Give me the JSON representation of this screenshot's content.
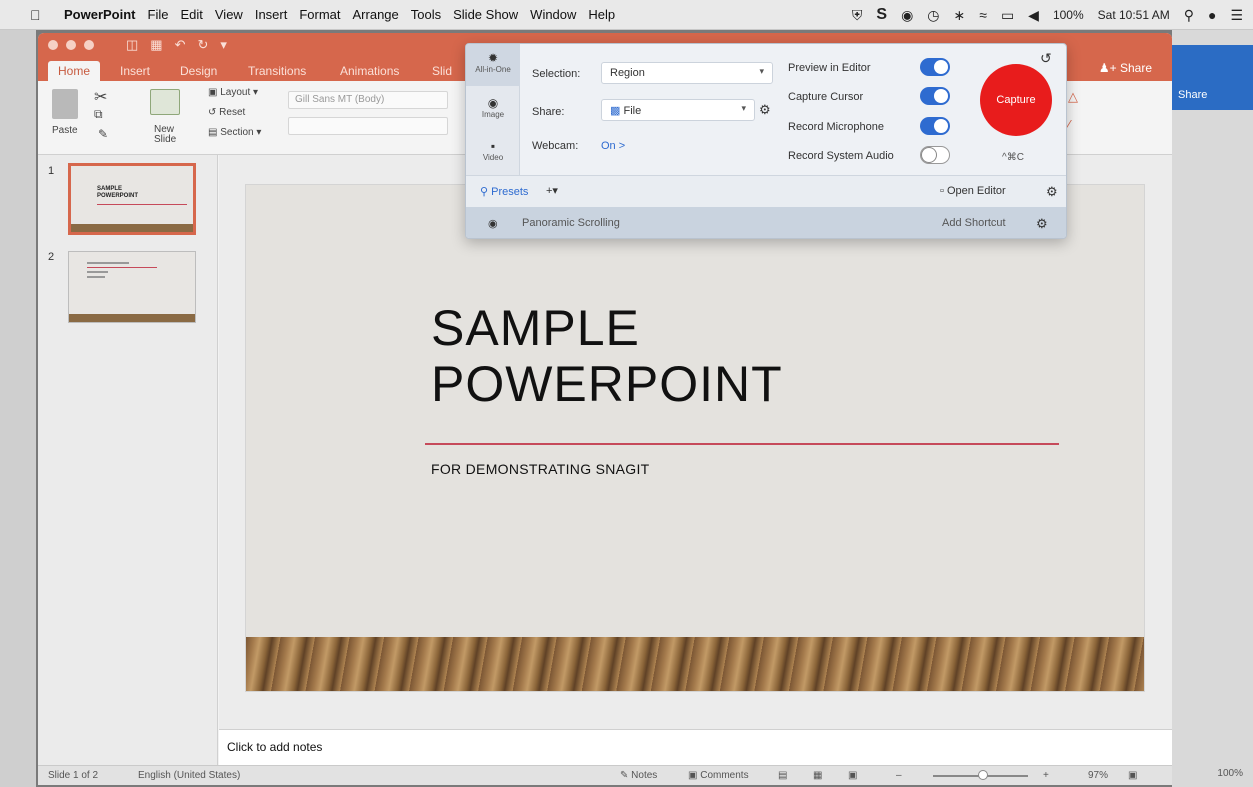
{
  "menubar": {
    "app": "PowerPoint",
    "menus": [
      "File",
      "Edit",
      "View",
      "Insert",
      "Format",
      "Arrange",
      "Tools",
      "Slide Show",
      "Window",
      "Help"
    ],
    "battery": "100%",
    "clock": "Sat 10:51 AM"
  },
  "ribbon": {
    "tabs": [
      "Home",
      "Insert",
      "Design",
      "Transitions",
      "Animations",
      "Slid"
    ],
    "share": "Share",
    "paste": "Paste",
    "new_slide": "New Slide",
    "layout": "Layout",
    "reset": "Reset",
    "section": "Section",
    "font": "Gill Sans MT (Body)"
  },
  "right_panel": {
    "share": "Share",
    "zoom": "100%"
  },
  "thumbnails": [
    {
      "num": "1",
      "title": "SAMPLE POWERPOINT"
    },
    {
      "num": "2"
    }
  ],
  "slide": {
    "title_line1": "SAMPLE",
    "title_line2": "POWERPOINT",
    "subtitle": "FOR DEMONSTRATING SNAGIT"
  },
  "notes": {
    "placeholder": "Click to add notes"
  },
  "status": {
    "slide_info": "Slide 1 of 2",
    "language": "English (United States)",
    "notes_btn": "Notes",
    "comments_btn": "Comments",
    "zoom": "97%"
  },
  "snagit": {
    "modes": [
      "All-in-One",
      "Image",
      "Video"
    ],
    "selection_label": "Selection:",
    "selection_value": "Region",
    "share_label": "Share:",
    "share_value": "File",
    "webcam_label": "Webcam:",
    "webcam_value": "On >",
    "toggles": [
      {
        "label": "Preview in Editor",
        "on": true
      },
      {
        "label": "Capture Cursor",
        "on": true
      },
      {
        "label": "Record Microphone",
        "on": true
      },
      {
        "label": "Record System Audio",
        "on": false
      }
    ],
    "capture": "Capture",
    "shortcut": "^⌘C",
    "presets": "Presets",
    "open_editor": "Open Editor",
    "preset_item": "Panoramic Scrolling",
    "add_shortcut": "Add Shortcut"
  },
  "colors": {
    "accent": "#d6674c",
    "capture": "#e81c1c",
    "link": "#2e6bd0"
  }
}
